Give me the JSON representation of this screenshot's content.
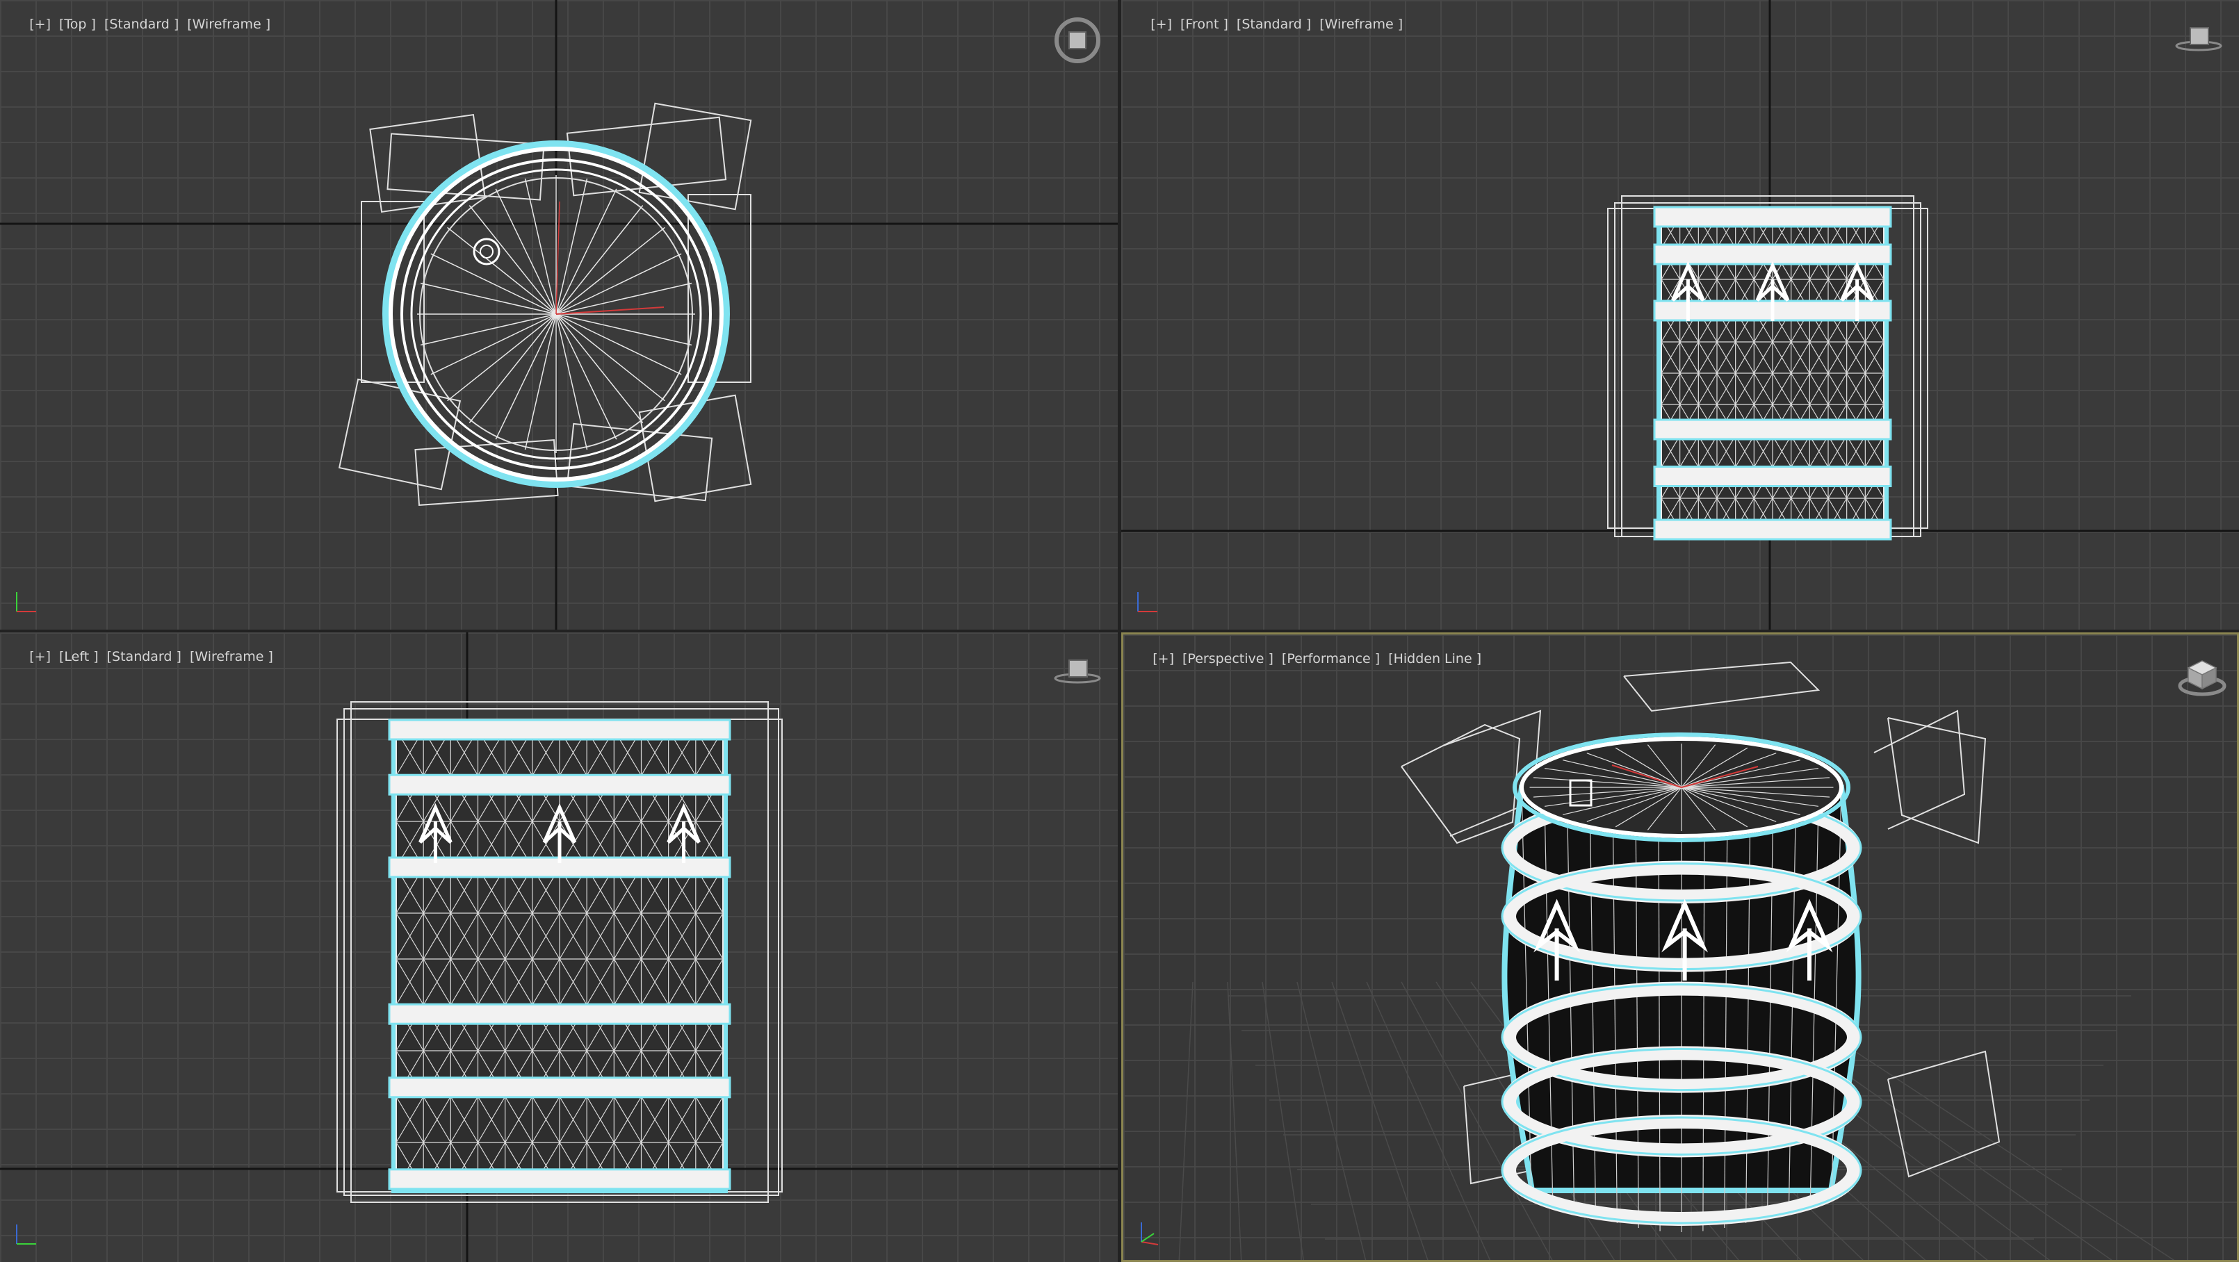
{
  "viewports": {
    "top": {
      "labels": [
        "[+]",
        "[Top ]",
        "[Standard ]",
        "[Wireframe ]"
      ],
      "nav_icon": "viewcube-top-icon"
    },
    "front": {
      "labels": [
        "[+]",
        "[Front ]",
        "[Standard ]",
        "[Wireframe ]"
      ],
      "nav_icon": "viewcube-front-icon"
    },
    "left": {
      "labels": [
        "[+]",
        "[Left ]",
        "[Standard ]",
        "[Wireframe ]"
      ],
      "nav_icon": "viewcube-left-icon"
    },
    "perspective": {
      "labels": [
        "[+]",
        "[Perspective ]",
        "[Performance ]",
        "[Hidden Line ]"
      ],
      "nav_icon": "viewcube-perspective-icon",
      "active": true
    }
  },
  "axes": {
    "x": "x",
    "y": "y",
    "z": "z"
  },
  "colors": {
    "viewport_bg": "#3a3a3a",
    "grid": "#484848",
    "wire": "#ffffff",
    "selection": "#7fe3f0",
    "active_border": "#8b8550",
    "axis_x": "#d33a3a",
    "axis_y": "#3ad33a",
    "axis_z": "#3a6ad3"
  }
}
